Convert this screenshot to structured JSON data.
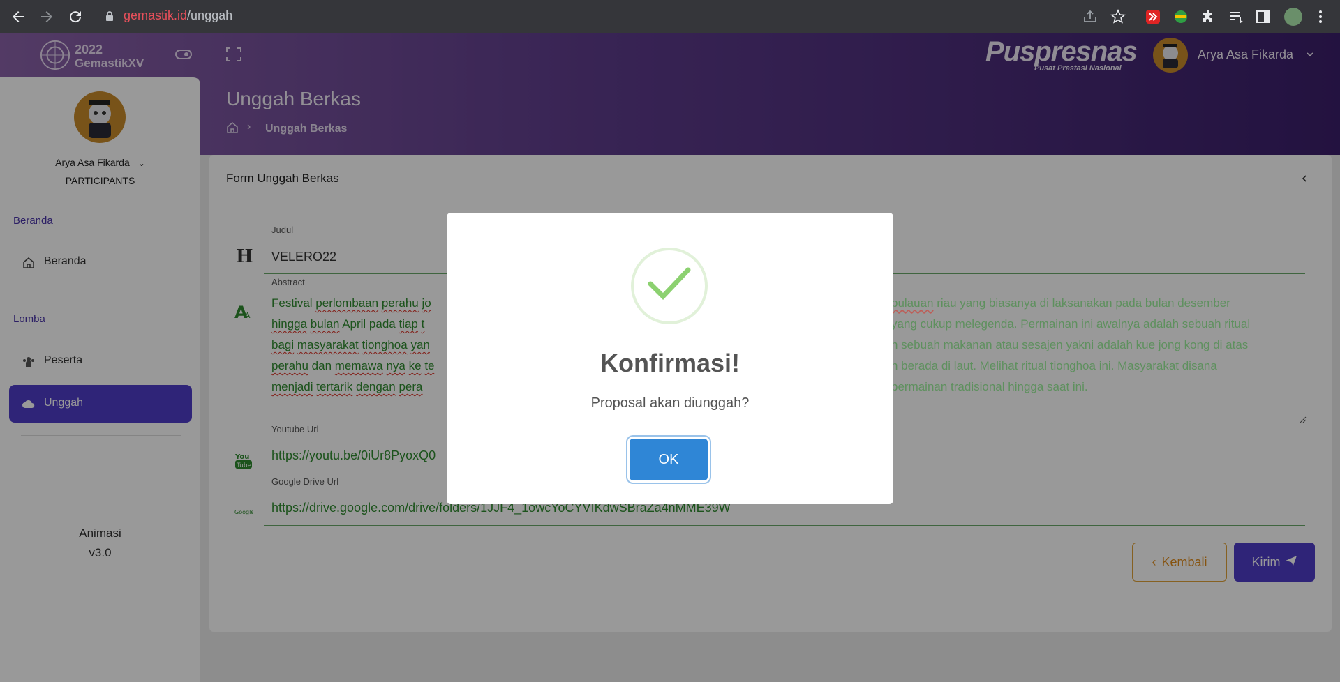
{
  "browser": {
    "url_host": "gemastik.id",
    "url_path": "/unggah"
  },
  "header": {
    "logo_year": "2022",
    "logo_name": "GemastikXV",
    "brand": "Puspresnas",
    "brand_sub": "Pusat Prestasi Nasional",
    "user_name": "Arya Asa Fikarda"
  },
  "sidebar": {
    "user_name": "Arya Asa Fikarda",
    "user_role": "PARTICIPANTS",
    "section_beranda": "Beranda",
    "item_beranda": "Beranda",
    "section_lomba": "Lomba",
    "item_peserta": "Peserta",
    "item_unggah": "Unggah",
    "footer_line1": "Animasi",
    "footer_line2": "v3.0"
  },
  "page": {
    "title": "Unggah Berkas",
    "breadcrumb_current": "Unggah Berkas"
  },
  "form": {
    "title": "Form Unggah Berkas",
    "judul_label": "Judul",
    "judul_value": "VELERO22",
    "abstract_label": "Abstract",
    "youtube_label": "Youtube Url",
    "youtube_value": "https://youtu.be/0iUr8PyoxQ0",
    "gdrive_label": "Google Drive Url",
    "gdrive_value": "https://drive.google.com/drive/folders/1JJF4_1owcYoCYVIKdwSBraZa4nMME39W",
    "btn_back": "Kembali",
    "btn_send": "Kirim"
  },
  "modal": {
    "title": "Konfirmasi!",
    "text": "Proposal akan diunggah?",
    "ok": "OK"
  },
  "colors": {
    "primary": "#4f3cc9",
    "success_text": "#2f8a2f",
    "modal_button": "#2f86d6"
  }
}
